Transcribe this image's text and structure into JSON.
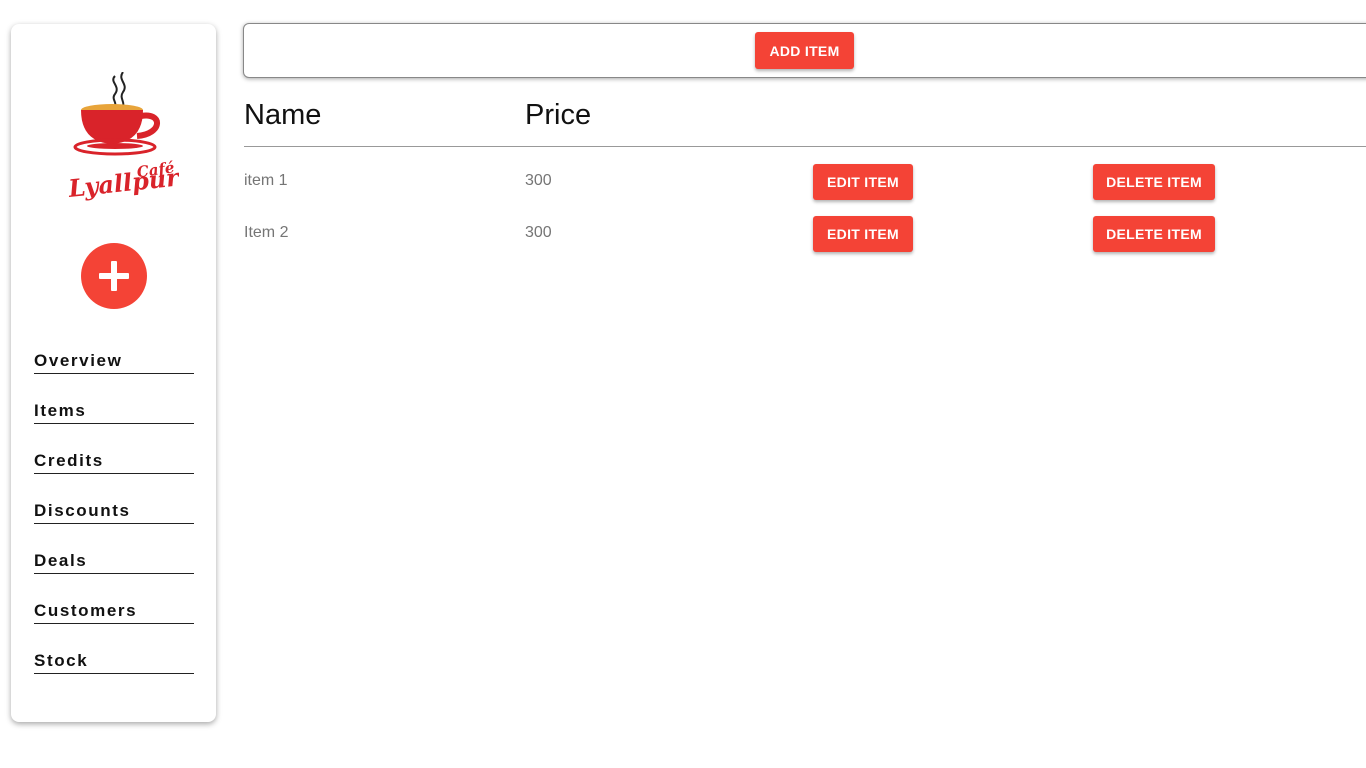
{
  "sidebar": {
    "logo": {
      "text_main": "Lyallpur",
      "text_sub": "Café"
    },
    "add_icon": "plus-icon",
    "nav_items": [
      {
        "label": "Overview"
      },
      {
        "label": "Items"
      },
      {
        "label": "Credits"
      },
      {
        "label": "Discounts"
      },
      {
        "label": "Deals"
      },
      {
        "label": "Customers"
      },
      {
        "label": "Stock"
      }
    ]
  },
  "toolbar": {
    "add_item_label": "ADD ITEM"
  },
  "table": {
    "headers": {
      "name": "Name",
      "price": "Price"
    },
    "rows": [
      {
        "name": "item 1",
        "price": "300",
        "edit_label": "EDIT ITEM",
        "delete_label": "DELETE ITEM"
      },
      {
        "name": "Item 2",
        "price": "300",
        "edit_label": "EDIT ITEM",
        "delete_label": "DELETE ITEM"
      }
    ]
  },
  "colors": {
    "accent": "#f44336",
    "text": "#111111",
    "muted_text": "#757575"
  }
}
